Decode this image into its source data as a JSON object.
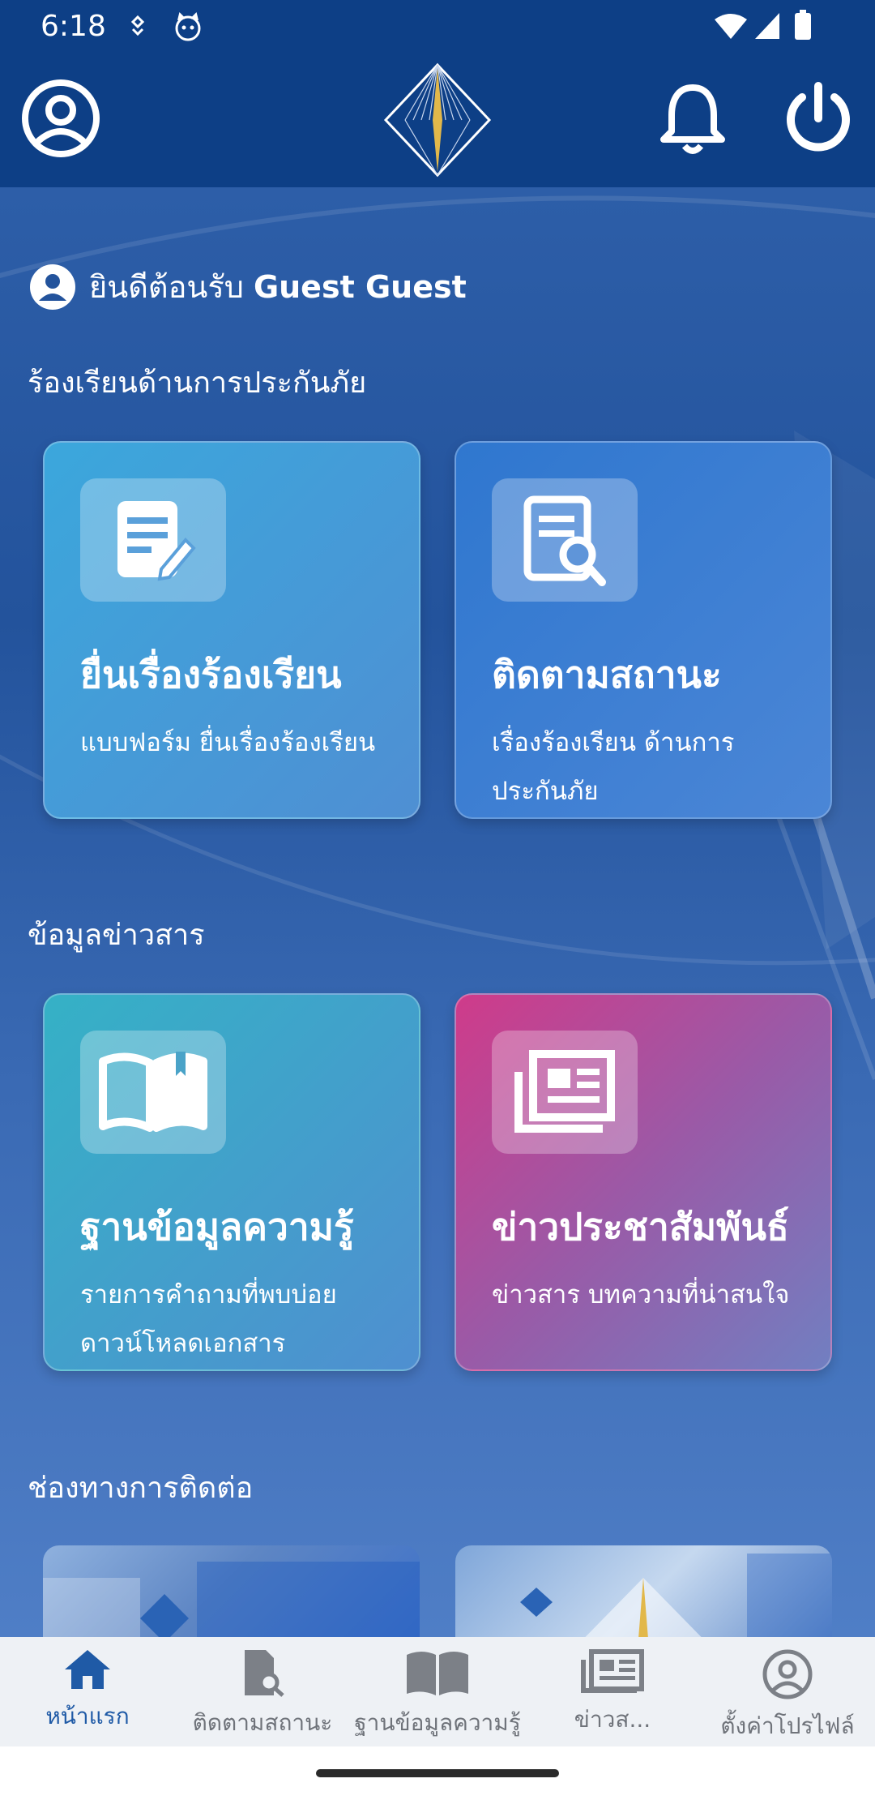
{
  "status_bar": {
    "time": "6:18"
  },
  "header": {
    "profile_icon": "account-circle-icon",
    "logo": "oic-emblem-logo",
    "notification_icon": "bell-icon",
    "power_icon": "power-icon"
  },
  "welcome": {
    "prefix": "ยินดีต้อนรับ",
    "name": "Guest Guest"
  },
  "sections": {
    "complaint": "ร้องเรียนด้านการประกันภัย",
    "info": "ข้อมูลข่าวสาร",
    "contact": "ช่องทางการติดต่อ"
  },
  "cards": {
    "file_complaint": {
      "title": "ยื่นเรื่องร้องเรียน",
      "subtitle": "แบบฟอร์ม ยื่นเรื่องร้องเรียน"
    },
    "track_status": {
      "title": "ติดตามสถานะ",
      "subtitle": "เรื่องร้องเรียน ด้านการประกันภัย"
    },
    "knowledge_base": {
      "title": "ฐานข้อมูลความรู้",
      "subtitle": "รายการคำถามที่พบบ่อย ดาวน์โหลดเอกสาร"
    },
    "news": {
      "title": "ข่าวประชาสัมพันธ์",
      "subtitle": "ข่าวสาร บทความที่น่าสนใจ"
    }
  },
  "bottom_nav": {
    "home": "หน้าแรก",
    "track": "ติดตามสถานะ",
    "knowledge": "ฐานข้อมูลความรู้",
    "news": "ข่าวส...",
    "settings": "ตั้งค่าโปรไฟล์"
  },
  "colors": {
    "primary": "#0d3f86",
    "active_nav": "#1f5aa6",
    "nav_bg": "#eef1f5"
  }
}
